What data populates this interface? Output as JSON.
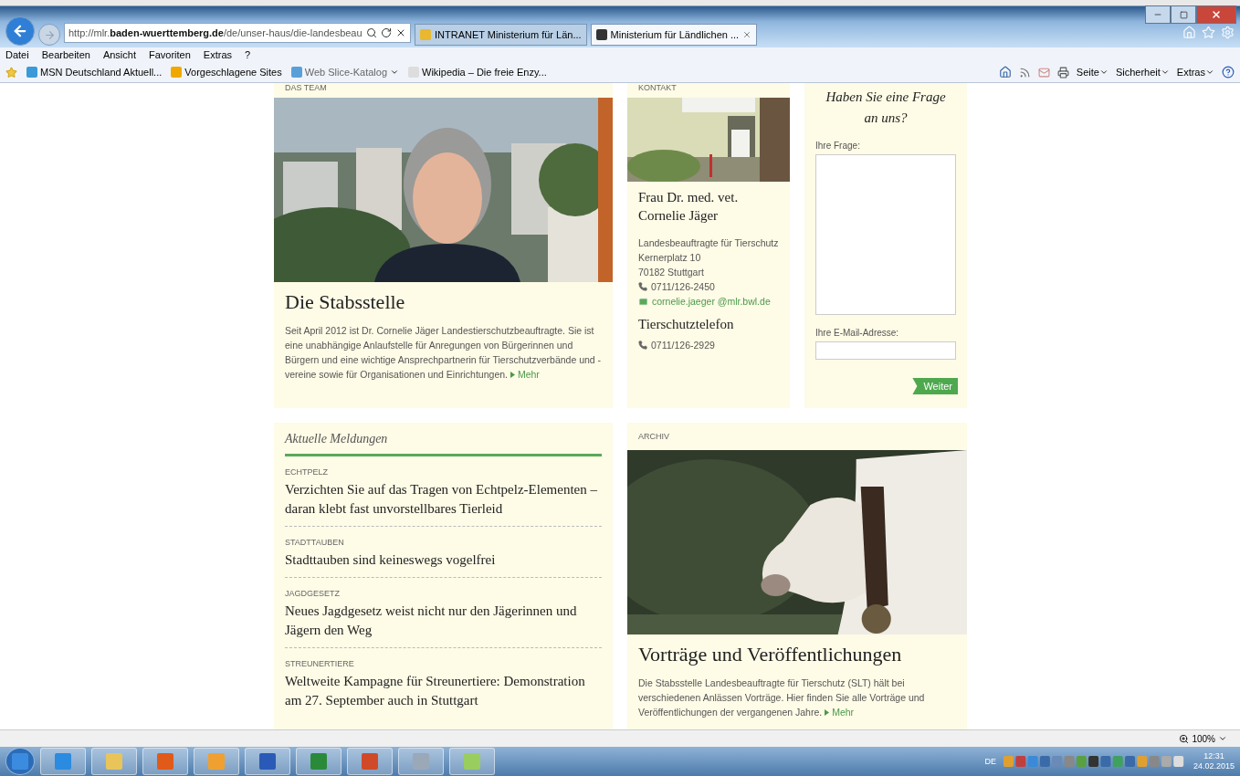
{
  "browser": {
    "address": {
      "prefix": "http://mlr.",
      "domain": "baden-wuerttemberg.de",
      "path": "/de/unser-haus/die-landesbeau"
    },
    "tabs": [
      {
        "label": "INTRANET Ministerium für Län...",
        "selected": false
      },
      {
        "label": "Ministerium für Ländlichen ...",
        "selected": true
      }
    ],
    "menu": [
      "Datei",
      "Bearbeiten",
      "Ansicht",
      "Favoriten",
      "Extras",
      "?"
    ],
    "favorites": [
      {
        "kind": "msn",
        "label": "MSN Deutschland Aktuell..."
      },
      {
        "kind": "bing",
        "label": "Vorgeschlagene Sites"
      },
      {
        "kind": "slice",
        "label": "Web Slice-Katalog"
      },
      {
        "kind": "wiki",
        "label": "Wikipedia – Die freie Enzy..."
      }
    ],
    "commands": [
      "Seite",
      "Sicherheit",
      "Extras"
    ]
  },
  "page": {
    "team": {
      "label": "DAS TEAM",
      "title": "Die Stabsstelle",
      "text": "Seit April 2012 ist Dr. Cornelie Jäger Landestierschutzbeauftragte. Sie ist eine unabhängige Anlaufstelle für Anregungen von Bürgerinnen und Bürgern und eine wichtige Ansprechpartnerin für Tierschutzverbände und -vereine sowie für Organisationen und Einrichtungen.",
      "more": "Mehr"
    },
    "contact": {
      "label": "KONTAKT",
      "name": [
        "Frau Dr. med. vet.",
        "Cornelie Jäger"
      ],
      "address": [
        "Landesbeauftragte für Tierschutz",
        "Kernerplatz 10",
        "70182 Stuttgart"
      ],
      "phone": "0711/126-2450",
      "email": "cornelie.jaeger @mlr.bwl.de",
      "hotline_title": "Tierschutztelefon",
      "hotline_phone": "0711/126-2929"
    },
    "question": {
      "title": [
        "Haben Sie eine Frage",
        "an uns?"
      ],
      "question_label": "Ihre Frage:",
      "email_label": "Ihre E-Mail-Adresse:",
      "button": "Weiter"
    },
    "news": {
      "title": "Aktuelle Meldungen",
      "items": [
        {
          "category": "ECHTPELZ",
          "headline": "Verzichten Sie auf das Tragen von Echtpelz-Elementen – daran klebt fast unvorstellbares Tierleid"
        },
        {
          "category": "STADTTAUBEN",
          "headline": "Stadttauben sind keineswegs vogelfrei"
        },
        {
          "category": "JAGDGESETZ",
          "headline": "Neues Jagdgesetz weist nicht nur den Jägerinnen und Jägern den Weg"
        },
        {
          "category": "STREUNERTIERE",
          "headline": "Weltweite Kampagne für Streunertiere: Demonstration am 27. September auch in Stuttgart"
        }
      ]
    },
    "archive": {
      "label": "ARCHIV",
      "title": "Vorträge und Veröffentlichungen",
      "text": "Die Stabsstelle Landesbeauftragte für Tierschutz (SLT) hält bei verschiedenen Anlässen Vorträge. Hier finden Sie alle Vorträge und Veröffentlichungen der vergangenen Jahre.",
      "more": "Mehr"
    }
  },
  "status": {
    "zoom": "100%"
  },
  "taskbar": {
    "apps": [
      {
        "kind": "start"
      },
      {
        "kind": "ie"
      },
      {
        "kind": "explorer"
      },
      {
        "kind": "media"
      },
      {
        "kind": "outlook"
      },
      {
        "kind": "word"
      },
      {
        "kind": "excel"
      },
      {
        "kind": "powerpoint"
      },
      {
        "kind": "tool"
      },
      {
        "kind": "notes"
      }
    ],
    "language": "DE",
    "time": "12:31",
    "date": "24.02.2015"
  }
}
